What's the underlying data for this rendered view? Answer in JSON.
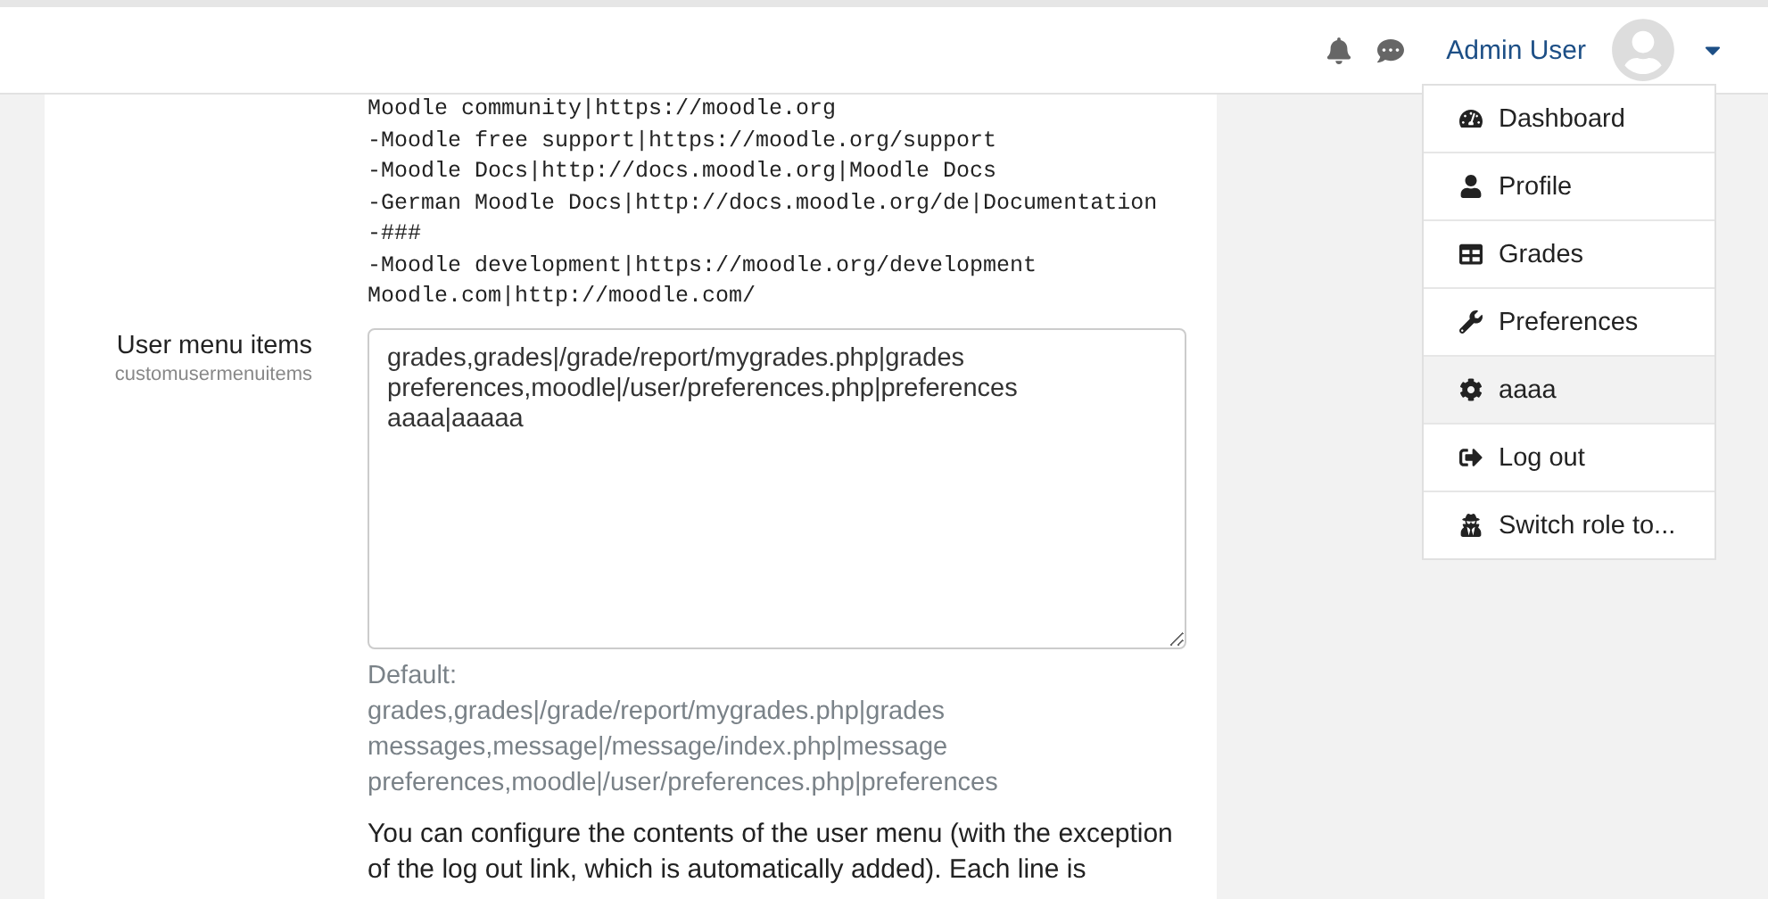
{
  "navbar": {
    "user_name": "Admin User"
  },
  "code_lines": [
    "Moodle community|https://moodle.org",
    "-Moodle free support|https://moodle.org/support",
    "-Moodle Docs|http://docs.moodle.org|Moodle Docs",
    "-German Moodle Docs|http://docs.moodle.org/de|Documentation",
    "-###",
    "-Moodle development|https://moodle.org/development",
    "Moodle.com|http://moodle.com/"
  ],
  "setting": {
    "label": "User menu items",
    "name": "customusermenuitems",
    "value": "grades,grades|/grade/report/mygrades.php|grades\npreferences,moodle|/user/preferences.php|preferences\naaaa|aaaaa",
    "default_label": "Default:",
    "default_lines": [
      "grades,grades|/grade/report/mygrades.php|grades",
      "messages,message|/message/index.php|message",
      "preferences,moodle|/user/preferences.php|preferences"
    ],
    "description": "You can configure the contents of the user menu (with the exception of the log out link, which is automatically added). Each line is"
  },
  "user_menu": [
    {
      "kind": "dashboard",
      "label": "Dashboard",
      "selected": false
    },
    {
      "kind": "profile",
      "label": "Profile",
      "selected": false
    },
    {
      "kind": "grades",
      "label": "Grades",
      "selected": false
    },
    {
      "kind": "preferences",
      "label": "Preferences",
      "selected": false
    },
    {
      "kind": "custom",
      "label": "aaaa",
      "selected": true
    },
    {
      "kind": "logout",
      "label": "Log out",
      "selected": false
    },
    {
      "kind": "switchrole",
      "label": "Switch role to...",
      "selected": false
    }
  ]
}
